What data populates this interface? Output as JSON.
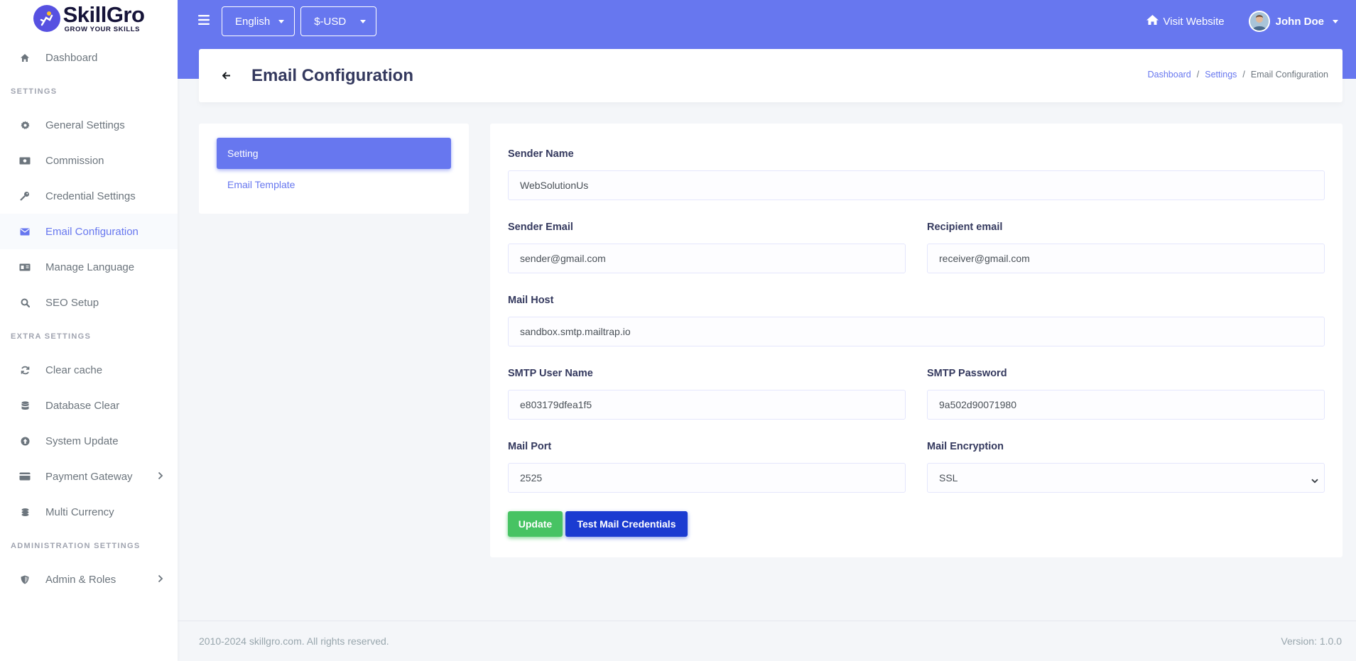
{
  "brand": {
    "name": "SkillGro",
    "tagline": "GROW YOUR SKILLS"
  },
  "sidebar": {
    "dashboard": "Dashboard",
    "section_settings": "SETTINGS",
    "settings_items": [
      {
        "label": "General Settings",
        "icon": "gear-icon"
      },
      {
        "label": "Commission",
        "icon": "money-icon"
      },
      {
        "label": "Credential Settings",
        "icon": "key-icon"
      },
      {
        "label": "Email Configuration",
        "icon": "envelope-icon",
        "active": true
      },
      {
        "label": "Manage Language",
        "icon": "language-icon"
      },
      {
        "label": "SEO Setup",
        "icon": "search-icon"
      }
    ],
    "section_extra": "EXTRA SETTINGS",
    "extra_items": [
      {
        "label": "Clear cache",
        "icon": "refresh-icon"
      },
      {
        "label": "Database Clear",
        "icon": "database-icon"
      },
      {
        "label": "System Update",
        "icon": "upload-icon"
      },
      {
        "label": "Payment Gateway",
        "icon": "credit-card-icon"
      },
      {
        "label": "Multi Currency",
        "icon": "coins-icon"
      }
    ],
    "section_admin": "ADMINISTRATION SETTINGS",
    "admin_items": [
      {
        "label": "Admin & Roles",
        "icon": "shield-icon"
      }
    ]
  },
  "topbar": {
    "language": "English",
    "currency": "$-USD",
    "visit_website": "Visit Website",
    "user_name": "John Doe"
  },
  "page": {
    "title": "Email Configuration",
    "breadcrumb": [
      "Dashboard",
      "Settings",
      "Email Configuration"
    ]
  },
  "tabs": {
    "active": "Setting",
    "other": "Email Template"
  },
  "form": {
    "sender_name_label": "Sender Name",
    "sender_name_value": "WebSolutionUs",
    "sender_email_label": "Sender Email",
    "sender_email_value": "sender@gmail.com",
    "recipient_email_label": "Recipient email",
    "recipient_email_value": "receiver@gmail.com",
    "mail_host_label": "Mail Host",
    "mail_host_value": "sandbox.smtp.mailtrap.io",
    "smtp_user_label": "SMTP User Name",
    "smtp_user_value": "e803179dfea1f5",
    "smtp_password_label": "SMTP Password",
    "smtp_password_value": "9a502d90071980",
    "mail_port_label": "Mail Port",
    "mail_port_value": "2525",
    "mail_encryption_label": "Mail Encryption",
    "mail_encryption_value": "SSL",
    "update_label": "Update",
    "test_label": "Test Mail Credentials"
  },
  "footer": {
    "copyright": "2010-2024 skillgro.com. All rights reserved.",
    "version": "Version: 1.0.0"
  },
  "colors": {
    "primary": "#6777ef",
    "success": "#47c363",
    "test_button": "#1b3bd1"
  }
}
